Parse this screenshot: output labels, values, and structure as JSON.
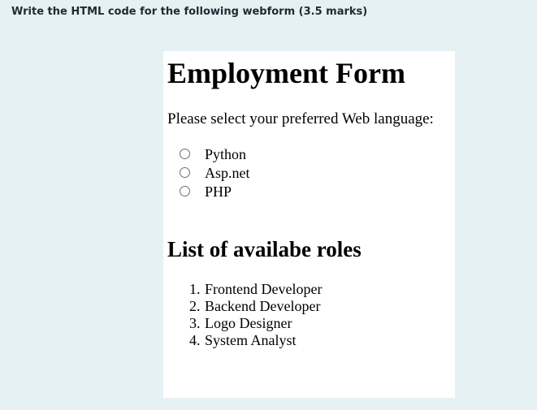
{
  "question": "Write the HTML code for the following webform (3.5 marks)",
  "form": {
    "title": "Employment Form",
    "prompt": "Please select your preferred Web language:",
    "options": [
      {
        "label": "Python",
        "selected": false
      },
      {
        "label": "Asp.net",
        "selected": false
      },
      {
        "label": "PHP",
        "selected": false
      }
    ],
    "roles_heading": "List of availabe roles",
    "roles": [
      {
        "number": "1.",
        "label": "Frontend Developer"
      },
      {
        "number": "2.",
        "label": "Backend Developer"
      },
      {
        "number": "3.",
        "label": "Logo Designer"
      },
      {
        "number": "4.",
        "label": "System Analyst"
      }
    ]
  }
}
